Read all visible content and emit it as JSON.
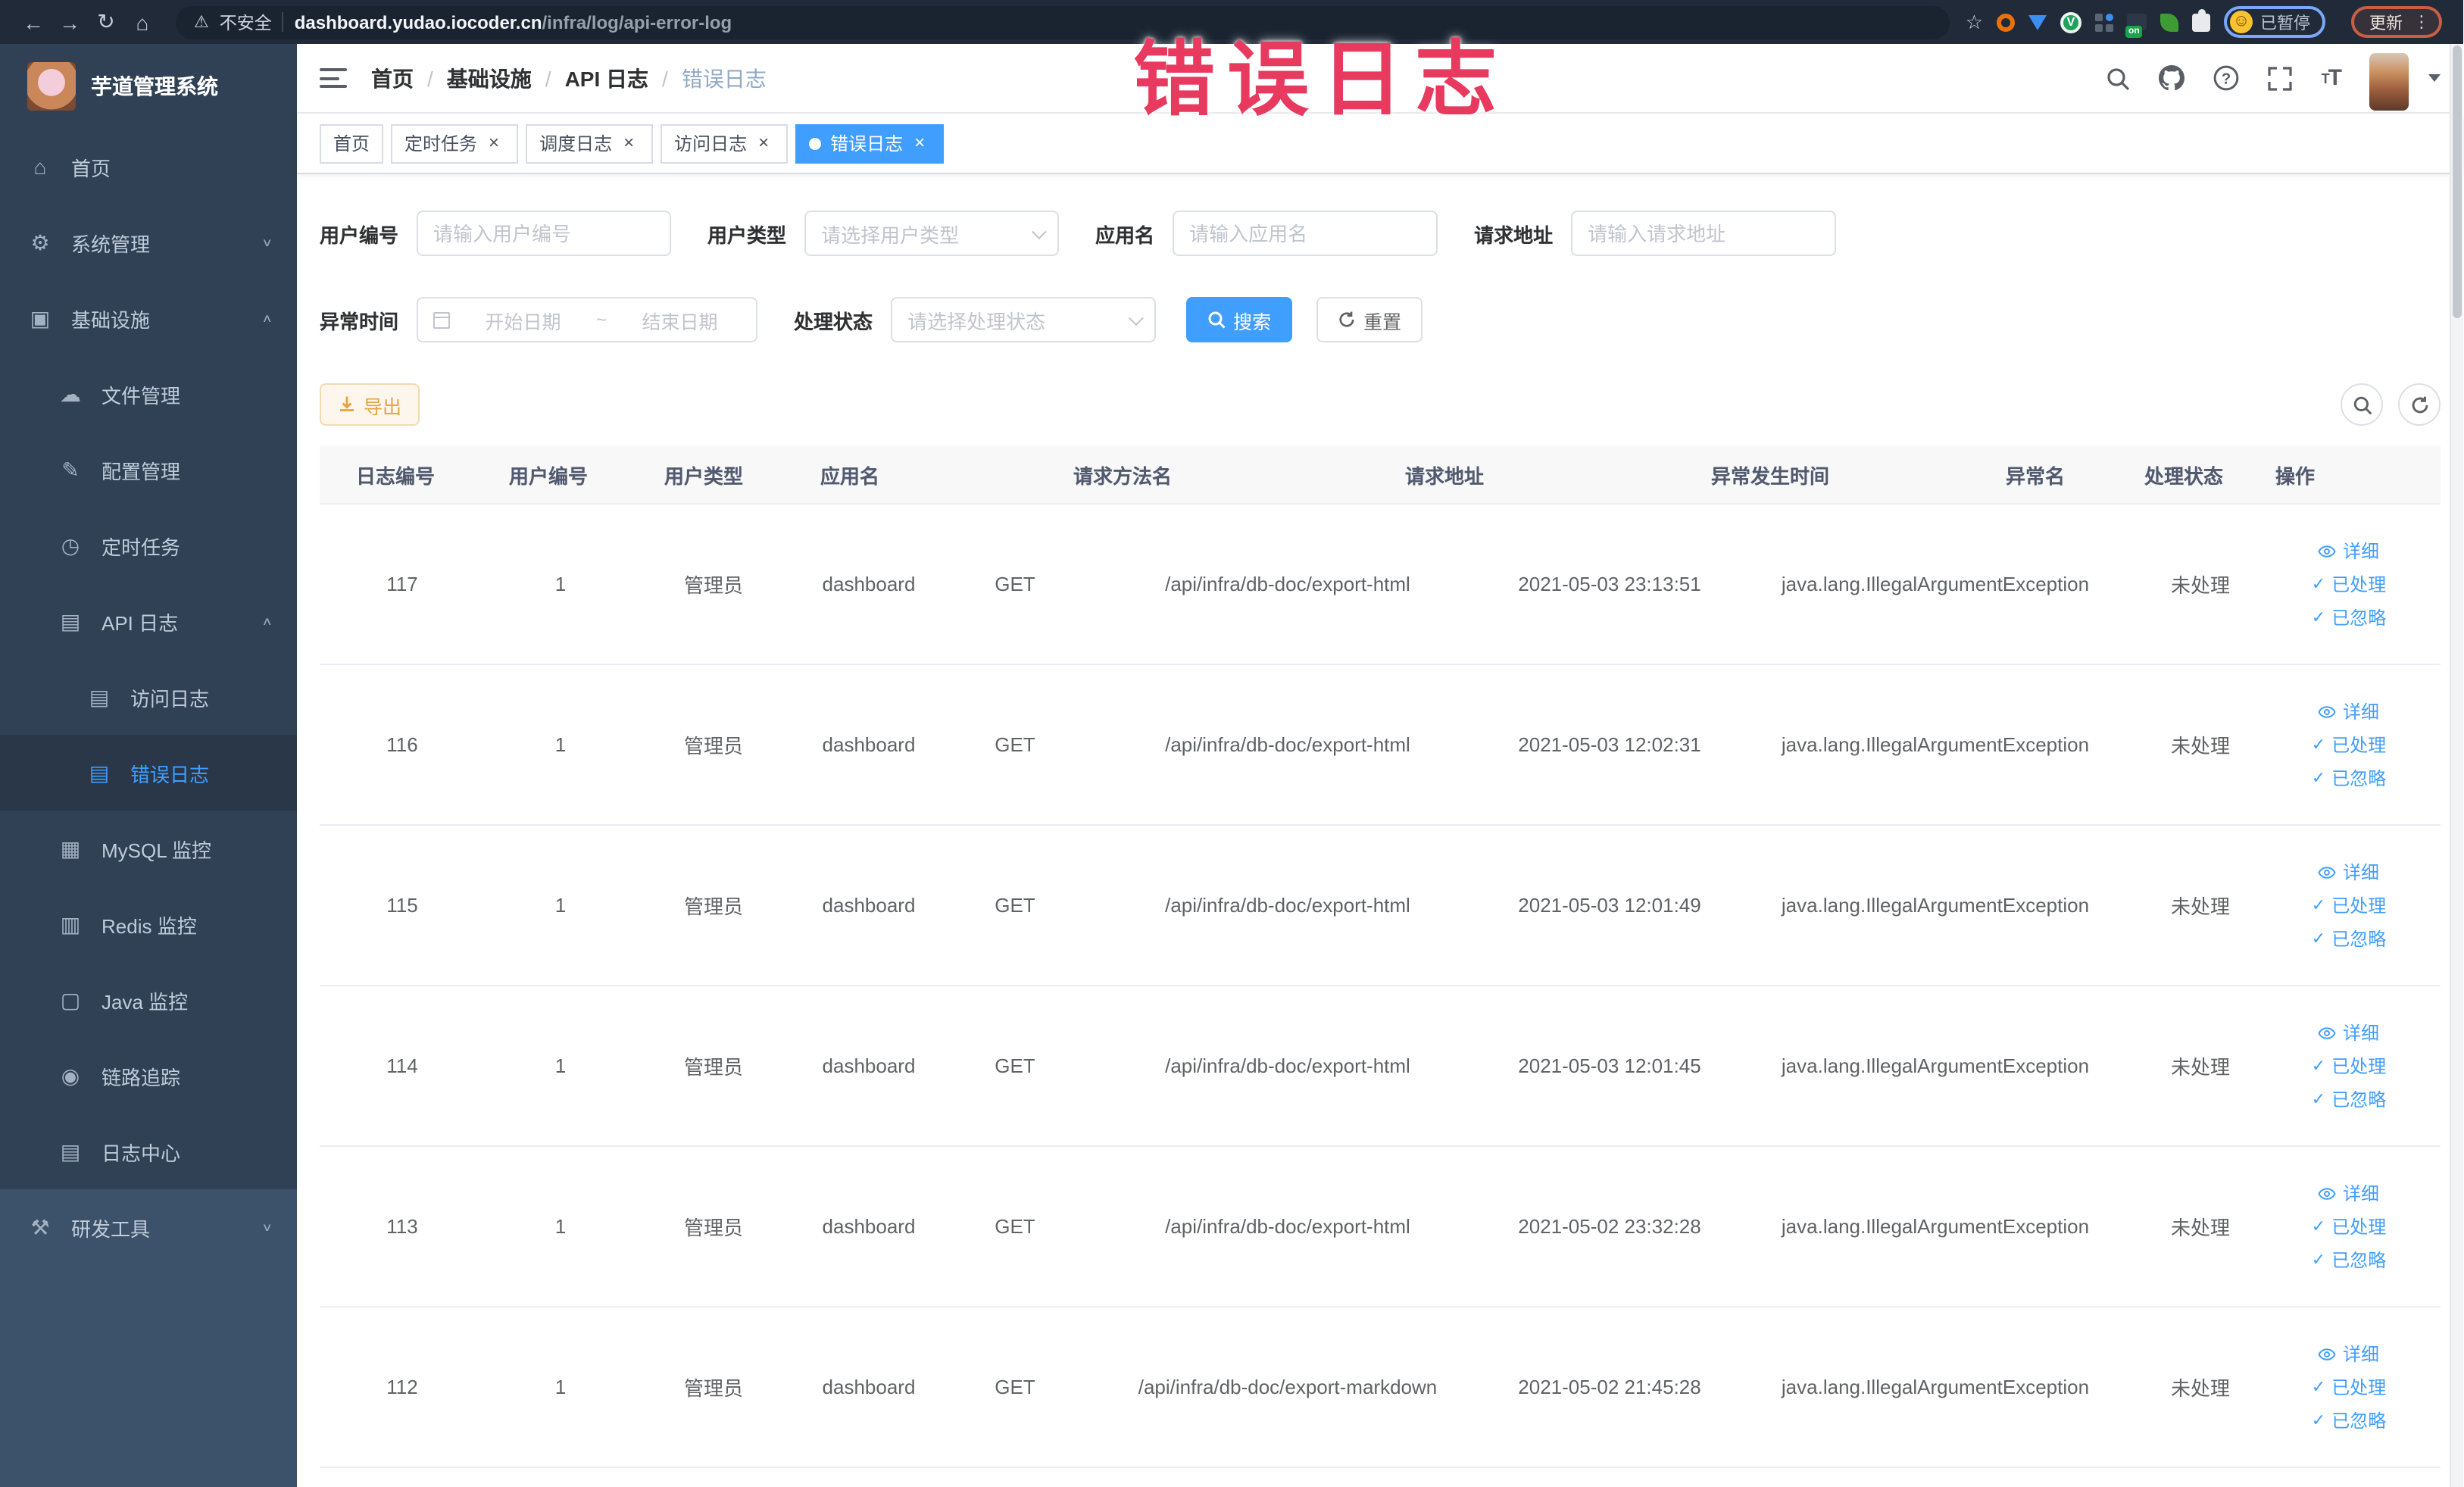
{
  "annotation": {
    "text": "错误日志"
  },
  "browser": {
    "nav_icons": [
      {
        "name": "back-arrow-icon",
        "glyph": "←"
      },
      {
        "name": "forward-arrow-icon",
        "glyph": "→"
      },
      {
        "name": "reload-icon",
        "glyph": "↻"
      },
      {
        "name": "home-icon",
        "glyph": "⌂"
      }
    ],
    "warning_icon_glyph": "⚠",
    "security_label": "不安全",
    "url_domain": "dashboard.yudao.iocoder.cn",
    "url_path": "/infra/log/api-error-log",
    "star_icon_glyph": "☆",
    "extension_icon_names": [
      "orange-ring-icon",
      "blue-shield-icon",
      "green-check-circle-icon",
      "apps-grid-icon",
      "toggle-on-icon",
      "leaf-icon",
      "puzzle-extension-icon"
    ],
    "green_circle_glyph": "V",
    "toggle_on_label": "on",
    "paused_avatar_glyph": "☺",
    "paused_badge": "已暂停",
    "update_button": "更新",
    "kebab_glyph": "⋮"
  },
  "sidebar": {
    "logo_title": "芋道管理系统",
    "items": [
      {
        "label": "首页",
        "icon": "home-icon",
        "glyph": "⌂",
        "level": 1
      },
      {
        "label": "系统管理",
        "icon": "gear-icon",
        "glyph": "⚙",
        "level": 1,
        "chevron": "∨"
      },
      {
        "label": "基础设施",
        "icon": "infrastructure-icon",
        "glyph": "▣",
        "level": 1,
        "chevron": "∧"
      },
      {
        "label": "文件管理",
        "icon": "cloud-upload-icon",
        "glyph": "☁",
        "level": 2
      },
      {
        "label": "配置管理",
        "icon": "config-edit-icon",
        "glyph": "✎",
        "level": 2
      },
      {
        "label": "定时任务",
        "icon": "timer-icon",
        "glyph": "◷",
        "level": 2
      },
      {
        "label": "API 日志",
        "icon": "api-log-icon",
        "glyph": "▤",
        "level": 2,
        "chevron": "∧"
      },
      {
        "label": "访问日志",
        "icon": "access-log-icon",
        "glyph": "▤",
        "level": 3
      },
      {
        "label": "错误日志",
        "icon": "error-log-icon",
        "glyph": "▤",
        "level": 3,
        "active": true
      },
      {
        "label": "MySQL 监控",
        "icon": "mysql-monitor-icon",
        "glyph": "▦",
        "level": 2
      },
      {
        "label": "Redis 监控",
        "icon": "redis-monitor-icon",
        "glyph": "▥",
        "level": 2
      },
      {
        "label": "Java 监控",
        "icon": "java-monitor-icon",
        "glyph": "▢",
        "level": 2
      },
      {
        "label": "链路追踪",
        "icon": "trace-eye-icon",
        "glyph": "◉",
        "level": 2
      },
      {
        "label": "日志中心",
        "icon": "log-center-icon",
        "glyph": "▤",
        "level": 2
      },
      {
        "label": "研发工具",
        "icon": "dev-tools-icon",
        "glyph": "⚒",
        "level": 1,
        "chevron": "∨",
        "section": "light"
      }
    ]
  },
  "header": {
    "breadcrumb": [
      {
        "label": "首页"
      },
      {
        "label": "基础设施"
      },
      {
        "label": "API 日志"
      },
      {
        "label": "错误日志",
        "current": true
      }
    ],
    "icon_names": [
      "search-icon",
      "github-icon",
      "help-icon",
      "fullscreen-icon",
      "font-size-icon",
      "avatar",
      "chevron-down-icon"
    ]
  },
  "tabs": [
    {
      "label": "首页",
      "closable": false
    },
    {
      "label": "定时任务",
      "closable": true
    },
    {
      "label": "调度日志",
      "closable": true
    },
    {
      "label": "访问日志",
      "closable": true
    },
    {
      "label": "错误日志",
      "closable": true,
      "active": true
    }
  ],
  "filters": {
    "user_id": {
      "label": "用户编号",
      "placeholder": "请输入用户编号"
    },
    "user_type": {
      "label": "用户类型",
      "placeholder": "请选择用户类型"
    },
    "app_name": {
      "label": "应用名",
      "placeholder": "请输入应用名"
    },
    "request_url": {
      "label": "请求地址",
      "placeholder": "请输入请求地址"
    },
    "exception_time": {
      "label": "异常时间",
      "start_placeholder": "开始日期",
      "separator": "~",
      "end_placeholder": "结束日期"
    },
    "process_status": {
      "label": "处理状态",
      "placeholder": "请选择处理状态"
    },
    "search_button": "搜索",
    "reset_button": "重置"
  },
  "toolbar": {
    "export_button": "导出",
    "icon_names": [
      "search-toggle-icon",
      "refresh-icon"
    ]
  },
  "table": {
    "columns": [
      "日志编号",
      "用户编号",
      "用户类型",
      "应用名",
      "请求方法名",
      "请求地址",
      "异常发生时间",
      "异常名",
      "处理状态",
      "操作"
    ],
    "rows": [
      {
        "id": "117",
        "user_id": "1",
        "user_type": "管理员",
        "app_name": "dashboard",
        "method": "GET",
        "url": "/api/infra/db-doc/export-html",
        "time": "2021-05-03 23:13:51",
        "exception": "java.lang.IllegalArgumentException",
        "status": "未处理"
      },
      {
        "id": "116",
        "user_id": "1",
        "user_type": "管理员",
        "app_name": "dashboard",
        "method": "GET",
        "url": "/api/infra/db-doc/export-html",
        "time": "2021-05-03 12:02:31",
        "exception": "java.lang.IllegalArgumentException",
        "status": "未处理"
      },
      {
        "id": "115",
        "user_id": "1",
        "user_type": "管理员",
        "app_name": "dashboard",
        "method": "GET",
        "url": "/api/infra/db-doc/export-html",
        "time": "2021-05-03 12:01:49",
        "exception": "java.lang.IllegalArgumentException",
        "status": "未处理"
      },
      {
        "id": "114",
        "user_id": "1",
        "user_type": "管理员",
        "app_name": "dashboard",
        "method": "GET",
        "url": "/api/infra/db-doc/export-html",
        "time": "2021-05-03 12:01:45",
        "exception": "java.lang.IllegalArgumentException",
        "status": "未处理"
      },
      {
        "id": "113",
        "user_id": "1",
        "user_type": "管理员",
        "app_name": "dashboard",
        "method": "GET",
        "url": "/api/infra/db-doc/export-html",
        "time": "2021-05-02 23:32:28",
        "exception": "java.lang.IllegalArgumentException",
        "status": "未处理"
      },
      {
        "id": "112",
        "user_id": "1",
        "user_type": "管理员",
        "app_name": "dashboard",
        "method": "GET",
        "url": "/api/infra/db-doc/export-markdown",
        "time": "2021-05-02 21:45:28",
        "exception": "java.lang.IllegalArgumentException",
        "status": "未处理"
      }
    ],
    "actions": [
      {
        "icon": "eye-icon",
        "label": "详细"
      },
      {
        "icon": "check-icon",
        "label": "已处理"
      },
      {
        "icon": "check-icon",
        "label": "已忽略"
      }
    ]
  },
  "colors": {
    "accent": "#409eff",
    "sidebar_bg": "#304156",
    "annotation": "#e83a5f",
    "export_warning": "#e6a23c",
    "topbar_bg": "#202a38"
  }
}
